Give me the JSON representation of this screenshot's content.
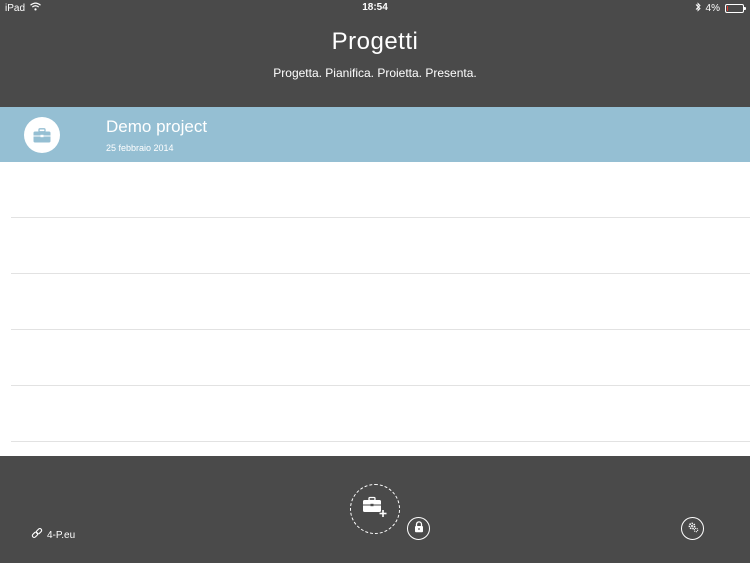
{
  "status_bar": {
    "device": "iPad",
    "time": "18:54",
    "battery_text": "4%",
    "battery_level": 0.04,
    "battery_color": "#e23b2d"
  },
  "header": {
    "title": "Progetti",
    "subtitle": "Progetta. Pianifica. Proietta. Presenta."
  },
  "projects": [
    {
      "name": "Demo project",
      "date": "25 febbraio 2014",
      "icon": "briefcase-icon"
    }
  ],
  "footer": {
    "site_label": "4-P.eu",
    "site_icon": "link-icon",
    "add_icon": "add-project-icon",
    "lock_icon": "lock-icon",
    "settings_icon": "gear-icon"
  },
  "colors": {
    "dark_bar": "#4a4a4a",
    "accent": "#95bfd3",
    "divider": "#e2e2e2"
  }
}
